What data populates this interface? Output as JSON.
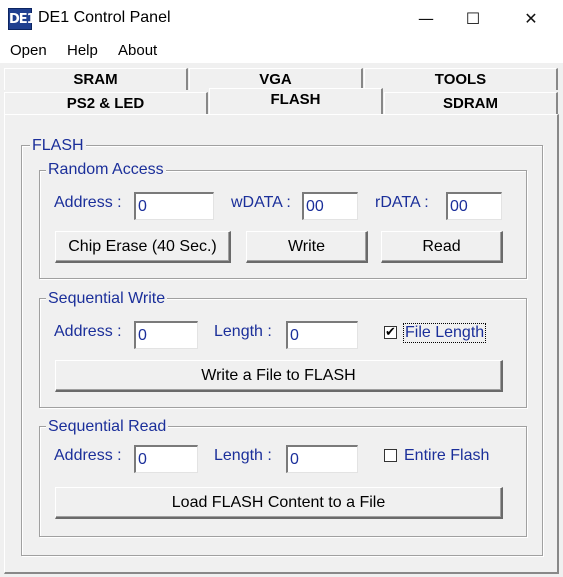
{
  "window": {
    "title": "DE1 Control Panel",
    "icon_label": "DE1",
    "minimize": "—",
    "maximize": "☐",
    "close": "✕"
  },
  "menu": [
    "Open",
    "Help",
    "About"
  ],
  "tabs": {
    "row1": [
      "SRAM",
      "VGA",
      "TOOLS"
    ],
    "row2": [
      "PS2 & LED",
      "FLASH",
      "SDRAM"
    ],
    "active": "FLASH"
  },
  "panel": {
    "title": "FLASH",
    "random_access": {
      "legend": "Random Access",
      "address_label": "Address :",
      "address_value": "0",
      "wdata_label": "wDATA :",
      "wdata_value": "00",
      "rdata_label": "rDATA :",
      "rdata_value": "00",
      "chip_erase_label": "Chip Erase (40 Sec.)",
      "write_label": "Write",
      "read_label": "Read"
    },
    "sequential_write": {
      "legend": "Sequential Write",
      "address_label": "Address :",
      "address_value": "0",
      "length_label": "Length :",
      "length_value": "0",
      "file_length_label": "File Length",
      "file_length_checked": true,
      "write_file_label": "Write a File to FLASH"
    },
    "sequential_read": {
      "legend": "Sequential Read",
      "address_label": "Address :",
      "address_value": "0",
      "length_label": "Length :",
      "length_value": "0",
      "entire_flash_label": "Entire Flash",
      "entire_flash_checked": false,
      "load_label": "Load FLASH Content to a File"
    }
  },
  "icons": {
    "app": "de1-logo-icon",
    "minimize": "minimize-icon",
    "maximize": "maximize-icon",
    "close": "close-icon",
    "check": "checkmark-icon"
  }
}
